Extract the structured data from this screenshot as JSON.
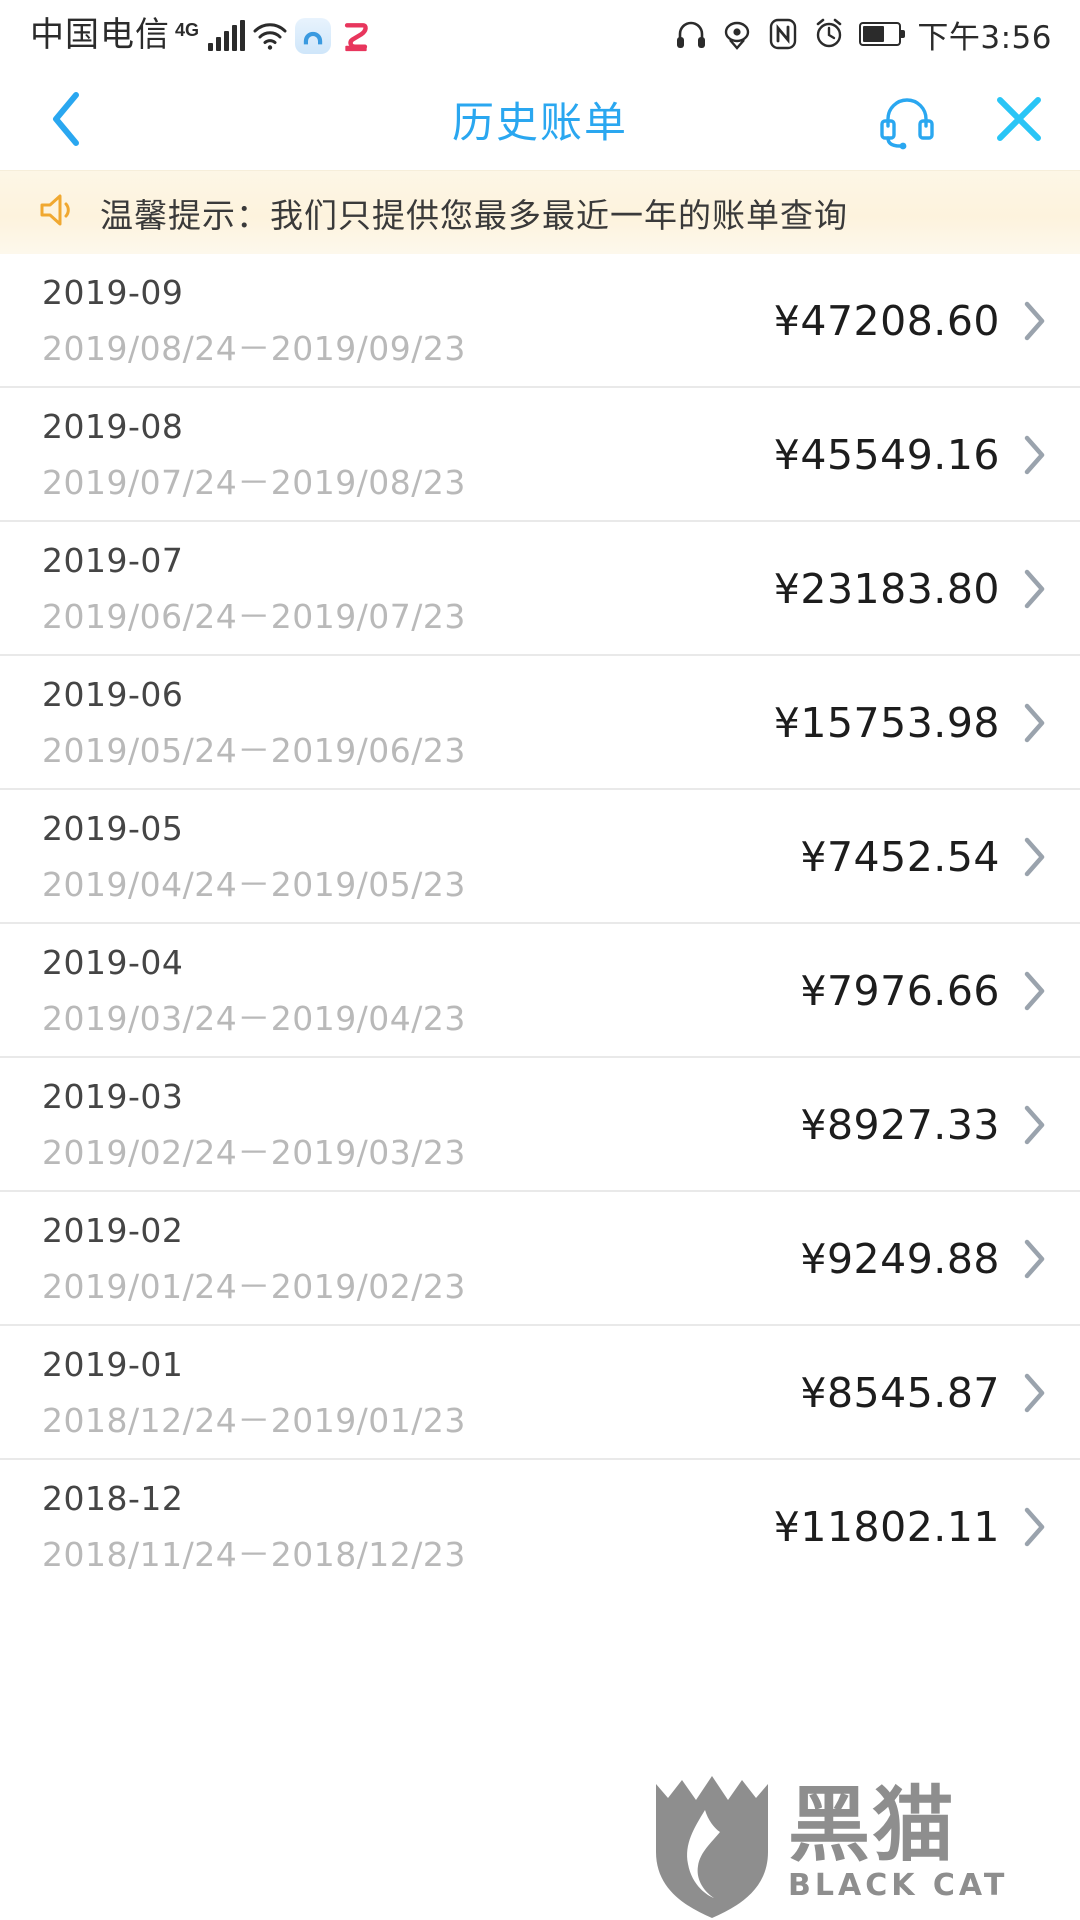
{
  "status_bar": {
    "carrier": "中国电信",
    "network": "4G",
    "time": "下午3:56",
    "icons": [
      "signal-bars-icon",
      "wifi-icon",
      "app-badge-icon",
      "youku-app-icon",
      "headset-icon",
      "eye-care-icon",
      "nfc-icon",
      "alarm-clock-icon",
      "battery-icon"
    ]
  },
  "nav": {
    "title": "历史账单",
    "back_icon": "chevron-left-icon",
    "service_icon": "headset-icon",
    "close_icon": "close-icon"
  },
  "notice": {
    "icon": "speaker-horn-icon",
    "text": "温馨提示：我们只提供您最多最近一年的账单查询"
  },
  "bills": {
    "chevron_icon": "chevron-right-icon",
    "currency": "¥",
    "items": [
      {
        "month": "2019-09",
        "range": "2019/08/24－2019/09/23",
        "amount": "¥47208.60"
      },
      {
        "month": "2019-08",
        "range": "2019/07/24－2019/08/23",
        "amount": "¥45549.16"
      },
      {
        "month": "2019-07",
        "range": "2019/06/24－2019/07/23",
        "amount": "¥23183.80"
      },
      {
        "month": "2019-06",
        "range": "2019/05/24－2019/06/23",
        "amount": "¥15753.98"
      },
      {
        "month": "2019-05",
        "range": "2019/04/24－2019/05/23",
        "amount": "¥7452.54"
      },
      {
        "month": "2019-04",
        "range": "2019/03/24－2019/04/23",
        "amount": "¥7976.66"
      },
      {
        "month": "2019-03",
        "range": "2019/02/24－2019/03/23",
        "amount": "¥8927.33"
      },
      {
        "month": "2019-02",
        "range": "2019/01/24－2019/02/23",
        "amount": "¥9249.88"
      },
      {
        "month": "2019-01",
        "range": "2018/12/24－2019/01/23",
        "amount": "¥8545.87"
      },
      {
        "month": "2018-12",
        "range": "2018/11/24－2018/12/23",
        "amount": "¥11802.11"
      }
    ]
  },
  "watermark": {
    "cn": "黑猫",
    "en": "BLACK CAT"
  },
  "colors": {
    "accent": "#2aa7f0",
    "notice_bg": "#fdf3dd",
    "notice_icon": "#f0a830",
    "amount": "#1d1d1d",
    "subtext": "#b9b9b9"
  }
}
